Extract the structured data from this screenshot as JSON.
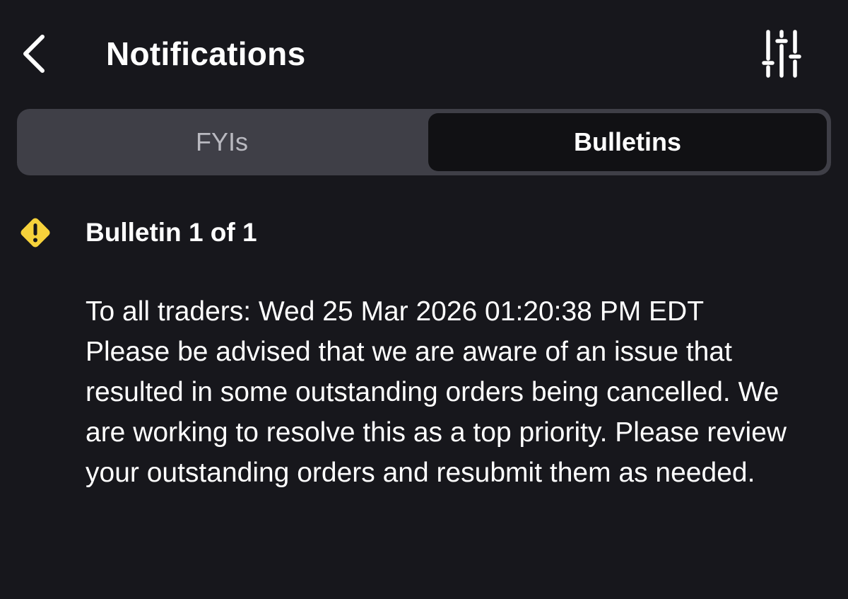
{
  "header": {
    "title": "Notifications",
    "back_icon": "chevron-left-icon",
    "filter_icon": "sliders-icon"
  },
  "tabs": [
    {
      "label": "FYIs",
      "selected": false
    },
    {
      "label": "Bulletins",
      "selected": true
    }
  ],
  "bulletin": {
    "icon": "warning-diamond-icon",
    "icon_color": "#f6d23b",
    "header": "Bulletin 1 of 1",
    "body": "To all traders: Wed 25 Mar 2026 01:20:38 PM EDT Please be advised that we are aware of an issue that resulted in some outstanding orders being cancelled. We are working to resolve this as a top priority. Please review your outstanding orders and resubmit them as needed."
  },
  "colors": {
    "background": "#17171c",
    "segmented_track": "#3f3f47",
    "segment_selected": "#111114",
    "text_primary": "#ffffff",
    "text_secondary": "#b9b9c0"
  }
}
